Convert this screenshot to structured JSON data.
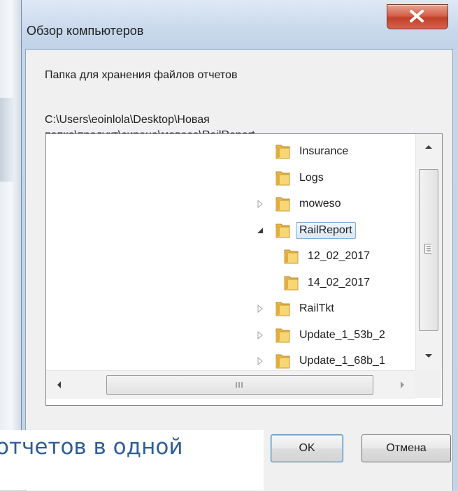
{
  "dialog": {
    "title": "Обзор компьютеров",
    "close_label": "X",
    "instruction": "Папка для хранения файлов отчетов",
    "path": "C:\\Users\\eoinlola\\Desktop\\Новая папка\\продукт\\сирена\\мовесо\\RailReport",
    "ok_label": "OK",
    "cancel_label": "Отмена"
  },
  "tree": {
    "items": [
      {
        "label": "Insurance",
        "expander": "none",
        "level": 0
      },
      {
        "label": "Logs",
        "expander": "none",
        "level": 0
      },
      {
        "label": "moweso",
        "expander": "collapsed",
        "level": 0
      },
      {
        "label": "RailReport",
        "expander": "expanded",
        "level": 0,
        "selected": true
      },
      {
        "label": "12_02_2017",
        "expander": "none",
        "level": 1
      },
      {
        "label": "14_02_2017",
        "expander": "none",
        "level": 1
      },
      {
        "label": "RailTkt",
        "expander": "collapsed",
        "level": 0
      },
      {
        "label": "Update_1_53b_2",
        "expander": "collapsed",
        "level": 0
      },
      {
        "label": "Update_1_68b_1",
        "expander": "collapsed",
        "level": 0
      }
    ]
  },
  "caption": {
    "text": "отчетов в одной"
  },
  "colors": {
    "caption_text": "#2e5d9a",
    "close_button": "#c2402a",
    "selection_border": "#84acdd",
    "folder": "#e8b84a"
  }
}
